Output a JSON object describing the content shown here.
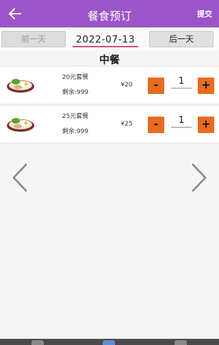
{
  "header": {
    "title": "餐食预订",
    "submit_label": "提交",
    "back_icon": "arrow-left-icon"
  },
  "date_bar": {
    "prev_label": "前一天",
    "date_value": "2022-07-13",
    "next_label": "后一天"
  },
  "meal": {
    "title": "中餐"
  },
  "packages": [
    {
      "name": "20元套餐",
      "remaining": "剩余:999",
      "price": "¥20",
      "quantity": "1",
      "minus_label": "-",
      "plus_label": "+"
    },
    {
      "name": "25元套餐",
      "remaining": "剩余:999",
      "price": "¥25",
      "quantity": "1",
      "minus_label": "-",
      "plus_label": "+"
    }
  ],
  "pager": {
    "prev_icon": "chevron-left-icon",
    "next_icon": "chevron-right-icon"
  },
  "colors": {
    "appbar": "#9b55c9",
    "stepper": "#e86c1e",
    "date_underline": "#d84a6c"
  }
}
